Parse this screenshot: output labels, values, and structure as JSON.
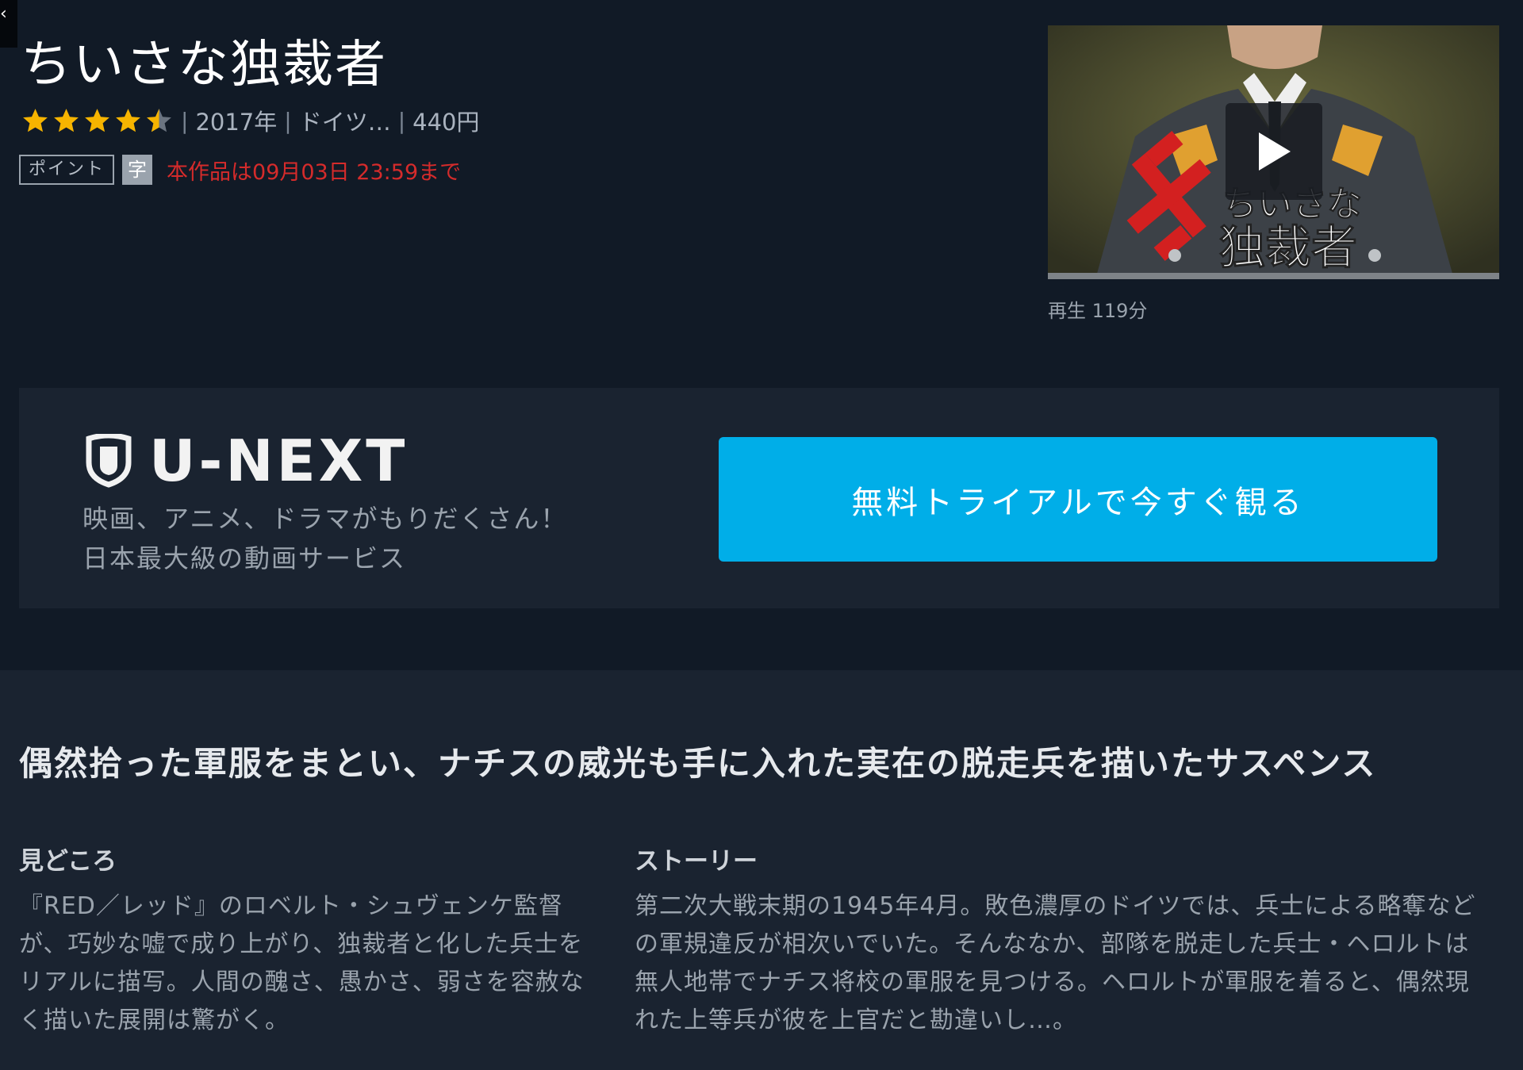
{
  "page": {
    "title": "ちいさな独裁者",
    "corner_glyph": "‹"
  },
  "meta": {
    "rating": 4.5,
    "year": "2017年",
    "country": "ドイツ…",
    "price": "440円"
  },
  "badges": {
    "point": "ポイント",
    "subtitle": "字",
    "expire_note": "本作品は09月03日 23:59まで"
  },
  "thumbnail": {
    "overlay_title_line1": "ちいさな",
    "overlay_title_line2": "独裁者",
    "playback_info": "再生 119分",
    "icon": "play-icon"
  },
  "promo": {
    "logo_text": "U-NEXT",
    "tagline_line1": "映画、アニメ、ドラマがもりだくさん！",
    "tagline_line2": "日本最大級の動画サービス",
    "cta_label": "無料トライアルで今すぐ観る",
    "cta_color": "#00aee8"
  },
  "details": {
    "catchphrase": "偶然拾った軍服をまとい、ナチスの威光も手に入れた実在の脱走兵を描いたサスペンス",
    "highlights_heading": "見どころ",
    "highlights_lines": [
      "『RED／レッド』のロベルト・シュヴェンケ監督",
      "が、巧妙な嘘で成り上がり、独裁者と化した兵士を",
      "リアルに描写。人間の醜さ、愚かさ、弱さを容赦な",
      "く描いた展開は驚がく。"
    ],
    "story_heading": "ストーリー",
    "story_lines": [
      "第二次大戦末期の1945年4月。敗色濃厚のドイツでは、兵士による略奪など",
      "の軍規違反が相次いでいた。そんななか、部隊を脱走した兵士・ヘロルトは",
      "無人地帯でナチス将校の軍服を見つける。ヘロルトが軍服を着ると、偶然現",
      "れた上等兵が彼を上官だと勘違いし…。"
    ]
  },
  "colors": {
    "background": "#111a26",
    "panel": "#1a2330",
    "star": "#f6b400",
    "alert": "#d52b2b"
  }
}
